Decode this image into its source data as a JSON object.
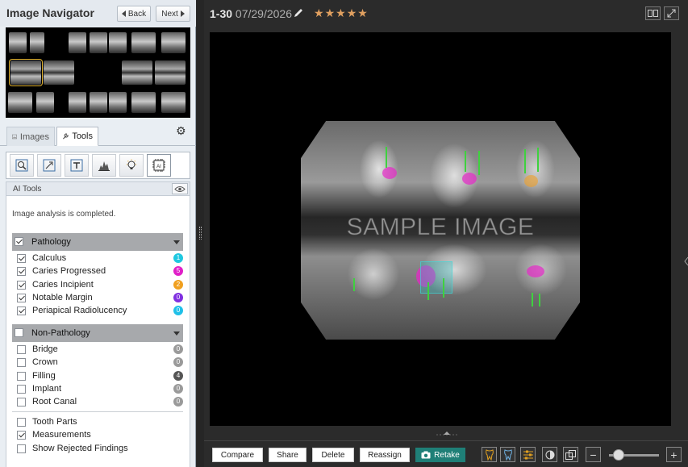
{
  "navigator": {
    "title": "Image Navigator",
    "back_label": "Back",
    "next_label": "Next"
  },
  "tabs": {
    "images": "Images",
    "tools": "Tools",
    "active": "tools"
  },
  "ai_tools": {
    "title": "AI Tools",
    "status": "Image analysis is completed."
  },
  "pathology": {
    "label": "Pathology",
    "checked": true,
    "items": [
      {
        "label": "Calculus",
        "count": "1",
        "color": "#1fc8e0",
        "checked": true
      },
      {
        "label": "Caries Progressed",
        "count": "5",
        "color": "#e020c8",
        "checked": true
      },
      {
        "label": "Caries Incipient",
        "count": "2",
        "color": "#f0a020",
        "checked": true
      },
      {
        "label": "Notable Margin",
        "count": "0",
        "color": "#8030e0",
        "checked": true
      },
      {
        "label": "Periapical Radiolucency",
        "count": "0",
        "color": "#20c0e8",
        "checked": true
      }
    ]
  },
  "non_pathology": {
    "label": "Non-Pathology",
    "checked": false,
    "items": [
      {
        "label": "Bridge",
        "count": "0",
        "color": "#9a9a9a",
        "checked": false
      },
      {
        "label": "Crown",
        "count": "0",
        "color": "#9a9a9a",
        "checked": false
      },
      {
        "label": "Filling",
        "count": "4",
        "color": "#555555",
        "checked": false
      },
      {
        "label": "Implant",
        "count": "0",
        "color": "#9a9a9a",
        "checked": false
      },
      {
        "label": "Root Canal",
        "count": "0",
        "color": "#9a9a9a",
        "checked": false
      }
    ]
  },
  "extras": [
    {
      "label": "Tooth Parts",
      "checked": false
    },
    {
      "label": "Measurements",
      "checked": true
    },
    {
      "label": "Show Rejected Findings",
      "checked": false
    }
  ],
  "image": {
    "id": "1-30",
    "date": "07/29/2026",
    "stars": 5,
    "watermark": "SAMPLE IMAGE"
  },
  "actions": {
    "compare": "Compare",
    "share": "Share",
    "delete": "Delete",
    "reassign": "Reassign",
    "retake": "Retake"
  },
  "zoom": {
    "level": 0.2
  },
  "colors": {
    "accent": "#1f7f77",
    "star": "#e0a060",
    "measurement": "#3fd13f"
  }
}
